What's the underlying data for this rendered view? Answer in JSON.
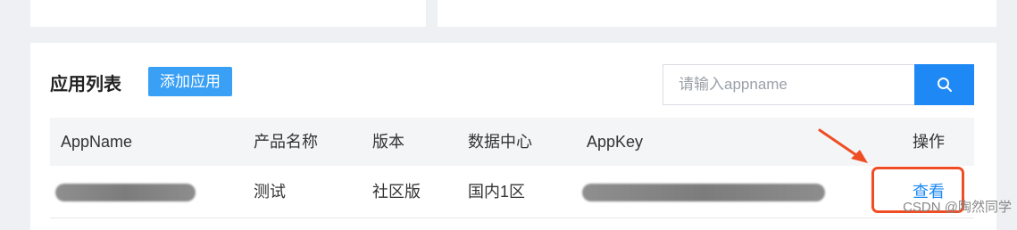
{
  "panel": {
    "title": "应用列表",
    "add_button_label": "添加应用"
  },
  "search": {
    "placeholder": "请输入appname"
  },
  "table": {
    "columns": [
      "AppName",
      "产品名称",
      "版本",
      "数据中心",
      "AppKey",
      "操作"
    ],
    "rows": [
      {
        "product_name": "测试",
        "version": "社区版",
        "data_center": "国内1区",
        "action_label": "查看"
      }
    ]
  },
  "watermark": "CSDN @陶然同学",
  "colors": {
    "accent": "#1e88f5",
    "add_button": "#3aa0f5",
    "highlight": "#ef4d24"
  },
  "icons": {
    "search_button": "search-icon",
    "annotation": "arrow-icon"
  }
}
